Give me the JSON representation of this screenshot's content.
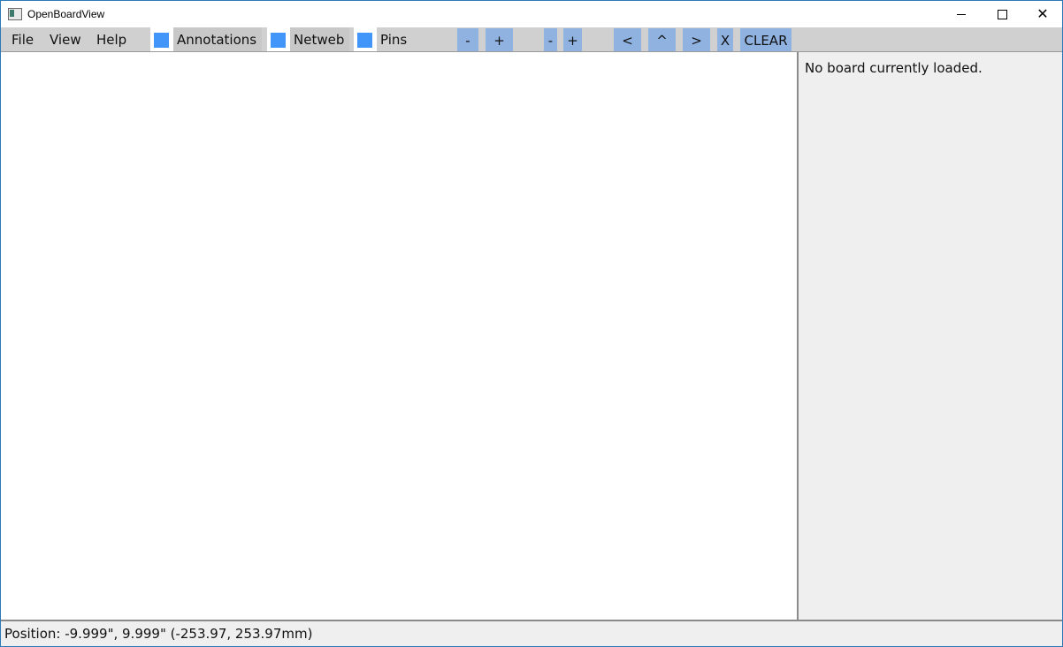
{
  "window": {
    "title": "OpenBoardView",
    "icons": {
      "app": "app-icon",
      "minimize": "minimize-icon",
      "maximize": "maximize-icon",
      "close": "close-icon"
    }
  },
  "menubar": {
    "menus": [
      {
        "label": "File"
      },
      {
        "label": "View"
      },
      {
        "label": "Help"
      }
    ],
    "toggles": [
      {
        "label": "Annotations",
        "checked": true
      },
      {
        "label": "Netweb",
        "checked": true
      },
      {
        "label": "Pins",
        "checked": true
      }
    ],
    "toolbar": {
      "zoom_out_1": "-",
      "zoom_in_1": "+",
      "zoom_out_2": "-",
      "zoom_in_2": "+",
      "prev": "<",
      "up": "^",
      "next": ">",
      "close": "X",
      "clear": "CLEAR"
    },
    "accent_color": "#4296f9"
  },
  "side_panel": {
    "message": "No board currently loaded."
  },
  "status_bar": {
    "position_text": "Position: -9.999\", 9.999\" (-253.97, 253.97mm)"
  }
}
